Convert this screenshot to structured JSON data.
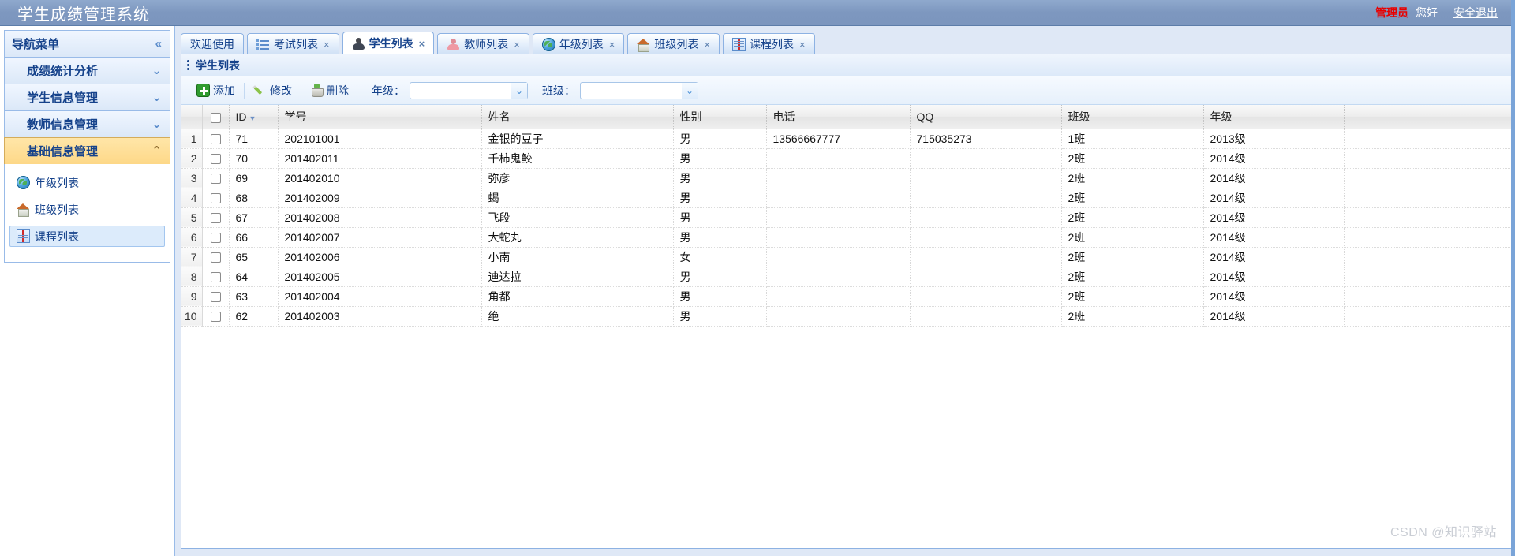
{
  "header": {
    "app_title": "学生成绩管理系统",
    "admin_name": "管理员",
    "greeting": "您好",
    "logout": "安全退出"
  },
  "sidebar": {
    "title": "导航菜单",
    "collapse_icon": "«",
    "groups": [
      {
        "label": "成绩统计分析",
        "expanded": false,
        "chevron": "⌄"
      },
      {
        "label": "学生信息管理",
        "expanded": false,
        "chevron": "⌄"
      },
      {
        "label": "教师信息管理",
        "expanded": false,
        "chevron": "⌄"
      },
      {
        "label": "基础信息管理",
        "expanded": true,
        "chevron": "⌃"
      }
    ],
    "sub_items": [
      {
        "label": "年级列表",
        "icon": "globe-icon",
        "selected": false
      },
      {
        "label": "班级列表",
        "icon": "house-icon",
        "selected": false
      },
      {
        "label": "课程列表",
        "icon": "book-icon",
        "selected": true
      }
    ]
  },
  "tabs": [
    {
      "label": "欢迎使用",
      "icon": "",
      "closable": false,
      "active": false
    },
    {
      "label": "考试列表",
      "icon": "list-icon",
      "closable": true,
      "active": false
    },
    {
      "label": "学生列表",
      "icon": "person-icon",
      "closable": true,
      "active": true
    },
    {
      "label": "教师列表",
      "icon": "person-pink-icon",
      "closable": true,
      "active": false
    },
    {
      "label": "年级列表",
      "icon": "globe-icon",
      "closable": true,
      "active": false
    },
    {
      "label": "班级列表",
      "icon": "house-icon",
      "closable": true,
      "active": false
    },
    {
      "label": "课程列表",
      "icon": "book-icon",
      "closable": true,
      "active": false
    }
  ],
  "panel": {
    "title": "学生列表",
    "toolbar": {
      "add_label": "添加",
      "edit_label": "修改",
      "delete_label": "删除",
      "grade_label": "年级：",
      "grade_value": "",
      "class_label": "班级：",
      "class_value": "",
      "dropdown_arrow": "⌄"
    }
  },
  "grid": {
    "sort_column": "ID",
    "sort_arrow": "▼",
    "columns": [
      "",
      "",
      "ID",
      "学号",
      "姓名",
      "性别",
      "电话",
      "QQ",
      "班级",
      "年级",
      ""
    ],
    "rows": [
      {
        "num": "1",
        "id": "71",
        "sno": "202101001",
        "name": "金银的豆子",
        "gender": "男",
        "phone": "13566667777",
        "qq": "715035273",
        "class": "1班",
        "grade": "2013级"
      },
      {
        "num": "2",
        "id": "70",
        "sno": "201402011",
        "name": "千柿鬼鲛",
        "gender": "男",
        "phone": "",
        "qq": "",
        "class": "2班",
        "grade": "2014级"
      },
      {
        "num": "3",
        "id": "69",
        "sno": "201402010",
        "name": "弥彦",
        "gender": "男",
        "phone": "",
        "qq": "",
        "class": "2班",
        "grade": "2014级"
      },
      {
        "num": "4",
        "id": "68",
        "sno": "201402009",
        "name": "蝎",
        "gender": "男",
        "phone": "",
        "qq": "",
        "class": "2班",
        "grade": "2014级"
      },
      {
        "num": "5",
        "id": "67",
        "sno": "201402008",
        "name": "飞段",
        "gender": "男",
        "phone": "",
        "qq": "",
        "class": "2班",
        "grade": "2014级"
      },
      {
        "num": "6",
        "id": "66",
        "sno": "201402007",
        "name": "大蛇丸",
        "gender": "男",
        "phone": "",
        "qq": "",
        "class": "2班",
        "grade": "2014级"
      },
      {
        "num": "7",
        "id": "65",
        "sno": "201402006",
        "name": "小南",
        "gender": "女",
        "phone": "",
        "qq": "",
        "class": "2班",
        "grade": "2014级"
      },
      {
        "num": "8",
        "id": "64",
        "sno": "201402005",
        "name": "迪达拉",
        "gender": "男",
        "phone": "",
        "qq": "",
        "class": "2班",
        "grade": "2014级"
      },
      {
        "num": "9",
        "id": "63",
        "sno": "201402004",
        "name": "角都",
        "gender": "男",
        "phone": "",
        "qq": "",
        "class": "2班",
        "grade": "2014级"
      },
      {
        "num": "10",
        "id": "62",
        "sno": "201402003",
        "name": "绝",
        "gender": "男",
        "phone": "",
        "qq": "",
        "class": "2班",
        "grade": "2014级"
      }
    ]
  },
  "watermark": "CSDN @知识驿站"
}
